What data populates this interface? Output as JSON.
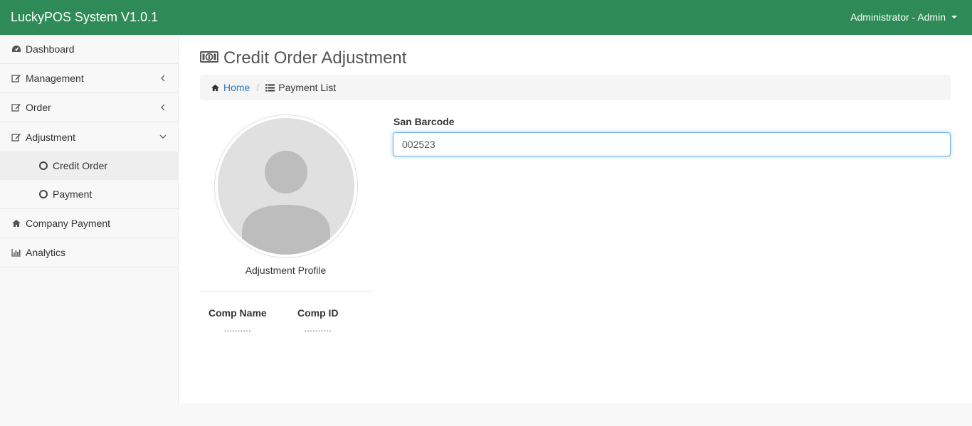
{
  "app": {
    "title": "LuckyPOS System V1.0.1",
    "user_menu": "Administrator - Admin"
  },
  "sidebar": {
    "dashboard": "Dashboard",
    "management": "Management",
    "order": "Order",
    "adjustment": "Adjustment",
    "adjustment_sub": {
      "credit_order": "Credit Order",
      "payment": "Payment"
    },
    "company_payment": "Company Payment",
    "analytics": "Analytics"
  },
  "page": {
    "title": "Credit Order Adjustment",
    "breadcrumb": {
      "home": "Home",
      "current": "Payment List"
    }
  },
  "profile": {
    "label": "Adjustment Profile",
    "comp_name_header": "Comp Name",
    "comp_name_value": "..........",
    "comp_id_header": "Comp ID",
    "comp_id_value": ".........."
  },
  "form": {
    "barcode_label": "San Barcode",
    "barcode_value": "002523"
  },
  "colors": {
    "header": "#2e8b57",
    "link": "#337ab7",
    "focus": "#66afe9"
  }
}
